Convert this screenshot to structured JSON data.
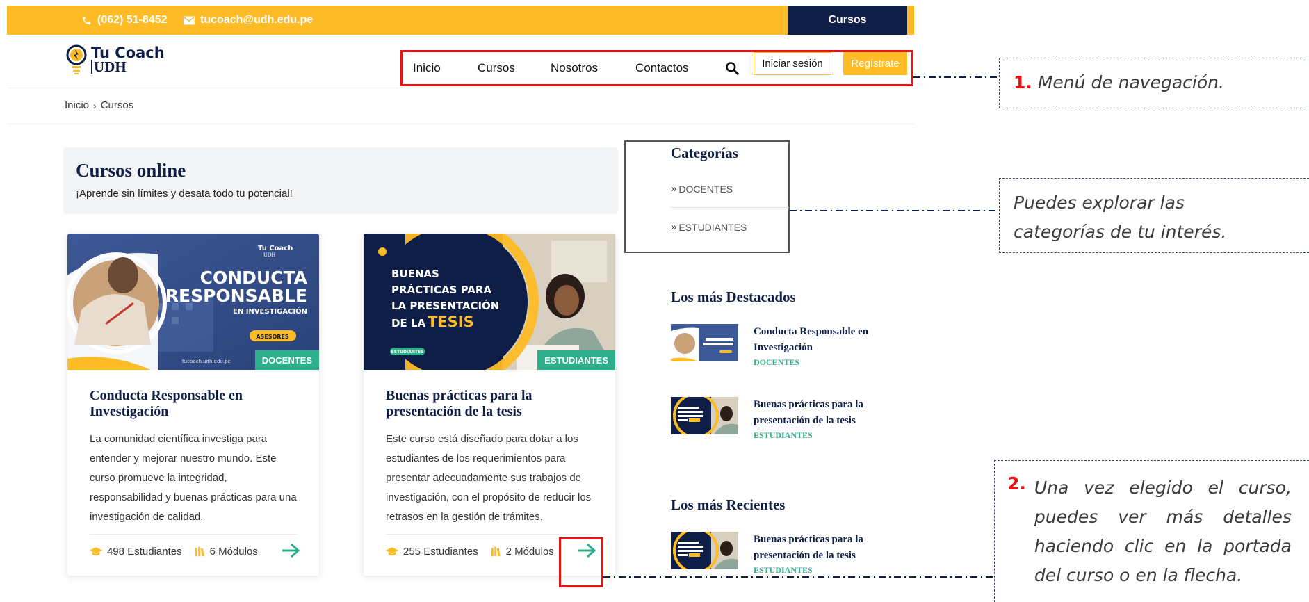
{
  "topbar": {
    "phone": "(062) 51-8452",
    "email": "tucoach@udh.edu.pe",
    "cursos_button": "Cursos",
    "bg_color": "#FDBB25",
    "dark_color": "#0e1e46"
  },
  "logo": {
    "line1": "Tu Coach",
    "line2": "UDH"
  },
  "nav": {
    "items": [
      "Inicio",
      "Cursos",
      "Nosotros",
      "Contactos"
    ],
    "search_icon": "search-icon",
    "login": "Iniciar sesión",
    "register": "Regístrate"
  },
  "breadcrumb": {
    "home": "Inicio",
    "current": "Cursos"
  },
  "hero": {
    "title": "Cursos online",
    "subtitle": "¡Aprende sin límites y desata todo tu potencial!"
  },
  "courses": [
    {
      "title": "Conducta Responsable en Investigación",
      "tag": "DOCENTES",
      "description": "La comunidad científica investiga para entender y mejorar nuestro mundo. Este curso promueve la integridad, responsabilidad y buenas prácticas para una investigación de calidad.",
      "students": "498 Estudiantes",
      "modules": "6 Módulos",
      "thumb": {
        "line1": "CONDUCTA",
        "line2": "RESPONSABLE",
        "line3": "EN INVESTIGACIÓN",
        "badge": "ASESORES",
        "url": "tucoach.udh.edu.pe",
        "brand1": "Tu Coach",
        "brand2": "UDH"
      }
    },
    {
      "title": "Buenas prácticas para la presentación de la tesis",
      "tag": "ESTUDIANTES",
      "description": "Este curso está diseñado para dotar a los estudiantes de los requerimientos para presentar adecuadamente sus trabajos de investigación, con el propósito de reducir los retrasos en la gestión de trámites.",
      "students": "255 Estudiantes",
      "modules": "2 Módulos",
      "thumb": {
        "line1": "BUENAS",
        "line2": "PRÁCTICAS PARA",
        "line3": "LA PRESENTACIÓN",
        "line4a": "DE LA ",
        "line4b": "TESIS",
        "badge": "ESTUDIANTES"
      }
    }
  ],
  "sidebar": {
    "categories_title": "Categorías",
    "categories": [
      "DOCENTES",
      "ESTUDIANTES"
    ],
    "featured_title": "Los más Destacados",
    "featured": [
      {
        "title": "Conducta Responsable en Investigación",
        "category": "DOCENTES"
      },
      {
        "title": "Buenas prácticas para la presentación de la tesis",
        "category": "ESTUDIANTES"
      }
    ],
    "recent_title": "Los más Recientes",
    "recent": [
      {
        "title": "Buenas prácticas para la presentación de la tesis",
        "category": "ESTUDIANTES"
      }
    ]
  },
  "annotations": {
    "a1_num": "1.",
    "a1_text": "Menú de navegación.",
    "a2_text": "Puedes explorar las categorías de tu interés.",
    "a3_num": "2.",
    "a3_text": "Una vez elegido el curso, puedes ver más detalles haciendo clic en la portada del curso o en la flecha."
  },
  "colors": {
    "accent_yellow": "#FDBB25",
    "navy": "#0e1e46",
    "green": "#2eae8a",
    "highlight_red": "#ee1111"
  }
}
